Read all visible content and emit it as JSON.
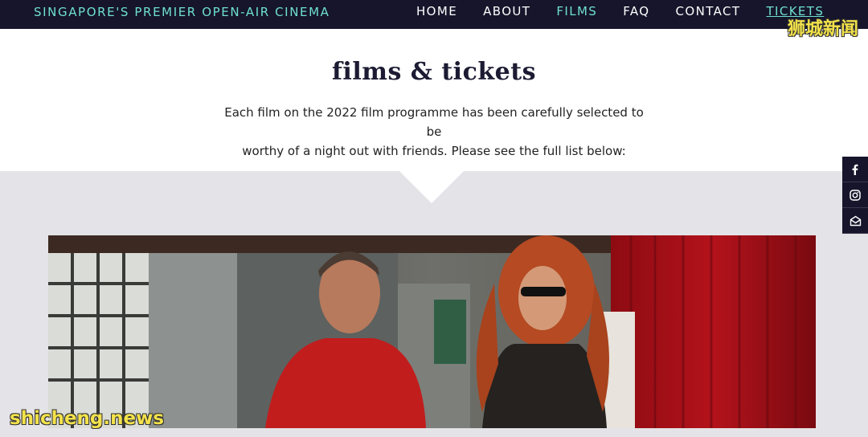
{
  "header": {
    "brand": "SINGAPORE'S PREMIER OPEN-AIR CINEMA",
    "nav": {
      "home": "HOME",
      "about": "ABOUT",
      "films": "FILMS",
      "faq": "FAQ",
      "contact": "CONTACT",
      "tickets": "TICKETS"
    },
    "active_item": "FILMS",
    "background": "#16152b",
    "accent": "#6fe0cf"
  },
  "main": {
    "title": "films & tickets",
    "intro_line1": "Each film on the 2022 film programme has been carefully selected to be",
    "intro_line2": "worthy of a night out with friends. Please see the full list below:"
  },
  "social": {
    "icons": [
      "facebook-icon",
      "instagram-icon",
      "newsletter-icon"
    ]
  },
  "watermarks": {
    "top_right": "狮城新闻",
    "bottom_left": "shicheng.news"
  }
}
